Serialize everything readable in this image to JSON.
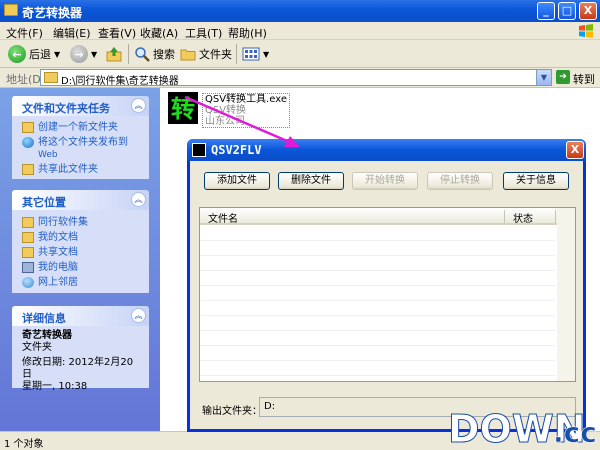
{
  "window": {
    "title": "奇艺转换器",
    "buttons": {
      "minimize": "_",
      "maximize": "□",
      "close": "X"
    }
  },
  "menu": {
    "items": [
      "文件(F)",
      "编辑(E)",
      "查看(V)",
      "收藏(A)",
      "工具(T)",
      "帮助(H)"
    ]
  },
  "toolbar": {
    "back": "后退",
    "search": "搜索",
    "folders": "文件夹"
  },
  "address": {
    "label": "地址(D)",
    "path": "D:\\同行软件集\\奇艺转换器",
    "go": "转到"
  },
  "taskpane": {
    "tasks": {
      "title": "文件和文件夹任务",
      "items": [
        "创建一个新文件夹",
        "将这个文件夹发布到",
        "Web",
        "共享此文件夹"
      ]
    },
    "places": {
      "title": "其它位置",
      "items": [
        "同行软件集",
        "我的文档",
        "共享文档",
        "我的电脑",
        "网上邻居"
      ]
    },
    "details": {
      "title": "详细信息",
      "name": "奇艺转换器",
      "type": "文件夹",
      "modified": "修改日期: 2012年2月20日",
      "weekday": "星期一, 10:38"
    }
  },
  "file": {
    "name": "QSV转换工具.exe",
    "desc": "QSV转换",
    "company": "山东公司",
    "icon_glyph": "转"
  },
  "status": {
    "text": "1 个对象"
  },
  "dialog": {
    "title": "QSV2FLV",
    "close": "X",
    "buttons": {
      "add": "添加文件",
      "remove": "删除文件",
      "start": "开始转换",
      "stop": "停止转换",
      "about": "关于信息"
    },
    "columns": {
      "name": "文件名",
      "status": "状态"
    },
    "output_label": "输出文件夹：",
    "output_value": "D:"
  },
  "watermark": {
    "text": "DOWN",
    "suffix": ".cc"
  },
  "colors": {
    "xp_blue": "#0a55d8",
    "task_link": "#215dc6",
    "annotation": "#e01bd8",
    "watermark": "#1a4fa8"
  }
}
